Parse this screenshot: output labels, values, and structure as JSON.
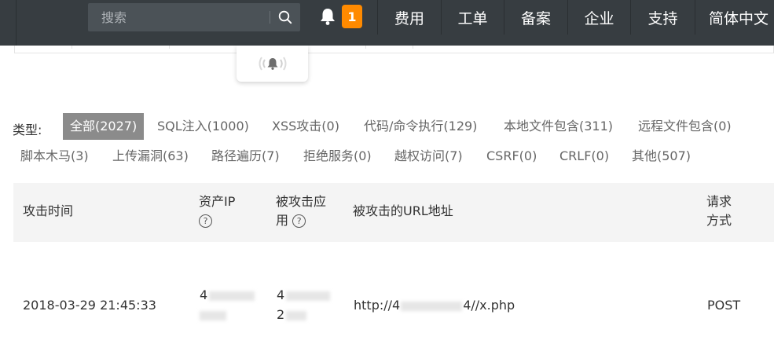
{
  "topbar": {
    "search_placeholder": "搜索",
    "notification_count": "1",
    "nav": [
      "费用",
      "工单",
      "备案",
      "企业",
      "支持",
      "简体中文"
    ]
  },
  "filter": {
    "label": "类型:",
    "chips": [
      "全部(2027)",
      "SQL注入(1000)",
      "XSS攻击(0)",
      "代码/命令执行(129)",
      "本地文件包含(311)",
      "远程文件包含(0)",
      "脚本木马(3)",
      "上传漏洞(63)",
      "路径遍历(7)",
      "拒绝服务(0)",
      "越权访问(7)",
      "CSRF(0)",
      "CRLF(0)",
      "其他(507)"
    ]
  },
  "table": {
    "headers": {
      "time": "攻击时间",
      "asset_ip": "资产IP",
      "app_line1": "被攻击应",
      "app_line2": "用",
      "url": "被攻击的URL地址",
      "method_line1": "请求",
      "method_line2": "方式"
    },
    "rows": [
      {
        "time": "2018-03-29 21:45:33",
        "ip_prefix": "4",
        "app_prefix_line1": "4",
        "app_prefix_line2": "2",
        "url_prefix": "http://4",
        "url_suffix": "4//x.php",
        "method": "POST"
      }
    ]
  },
  "colors": {
    "topbar_bg": "#373d41",
    "badge_bg": "#ff8a00",
    "active_chip_bg": "#8b8b8b",
    "table_header_bg": "#f4f4f4"
  }
}
